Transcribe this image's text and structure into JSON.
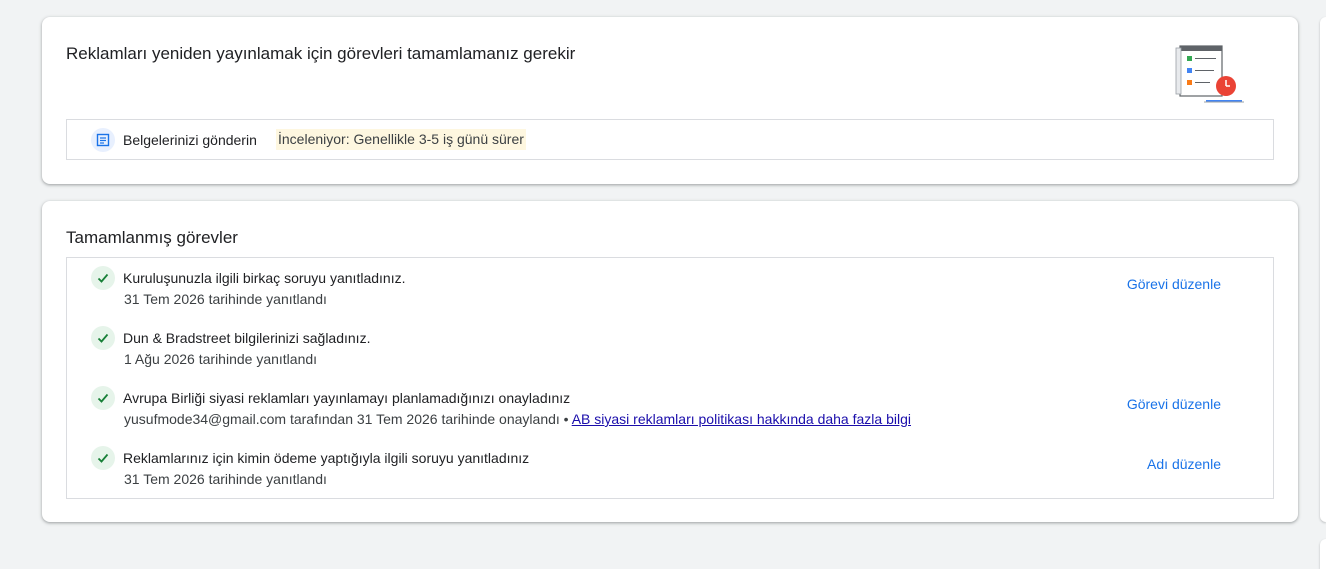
{
  "pending_card": {
    "title": "Reklamları yeniden yayınlamak için görevleri tamamlamanız gerekir",
    "illustration_icon": "checklist-clock-icon",
    "task": {
      "icon": "document-icon",
      "label": "Belgelerinizi gönderin",
      "status": "İnceleniyor: Genellikle 3-5 iş günü sürer"
    }
  },
  "completed_card": {
    "title": "Tamamlanmış görevler",
    "tasks": [
      {
        "title": "Kuruluşunuzla ilgili birkaç soruyu yanıtladınız.",
        "subtitle": "31 Tem 2026 tarihinde yanıtlandı",
        "action": "Görevi düzenle"
      },
      {
        "title": "Dun & Bradstreet bilgilerinizi sağladınız.",
        "subtitle": "1 Ağu 2026 tarihinde yanıtlandı",
        "action": ""
      },
      {
        "title": "Avrupa Birliği siyasi reklamları yayınlamayı planlamadığınızı onayladınız",
        "subtitle": "yusufmode34@gmail.com tarafından 31 Tem 2026 tarihinde onaylandı",
        "separator": " • ",
        "link": "AB siyasi reklamları politikası hakkında daha fazla bilgi",
        "action": "Görevi düzenle"
      },
      {
        "title": "Reklamlarınız için kimin ödeme yaptığıyla ilgili soruyu yanıtladınız",
        "subtitle": "31 Tem 2026 tarihinde yanıtlandı",
        "action": "Adı düzenle"
      }
    ]
  },
  "colors": {
    "link": "#1a73e8",
    "check": "#188038",
    "status_bg": "#fef7e0"
  }
}
